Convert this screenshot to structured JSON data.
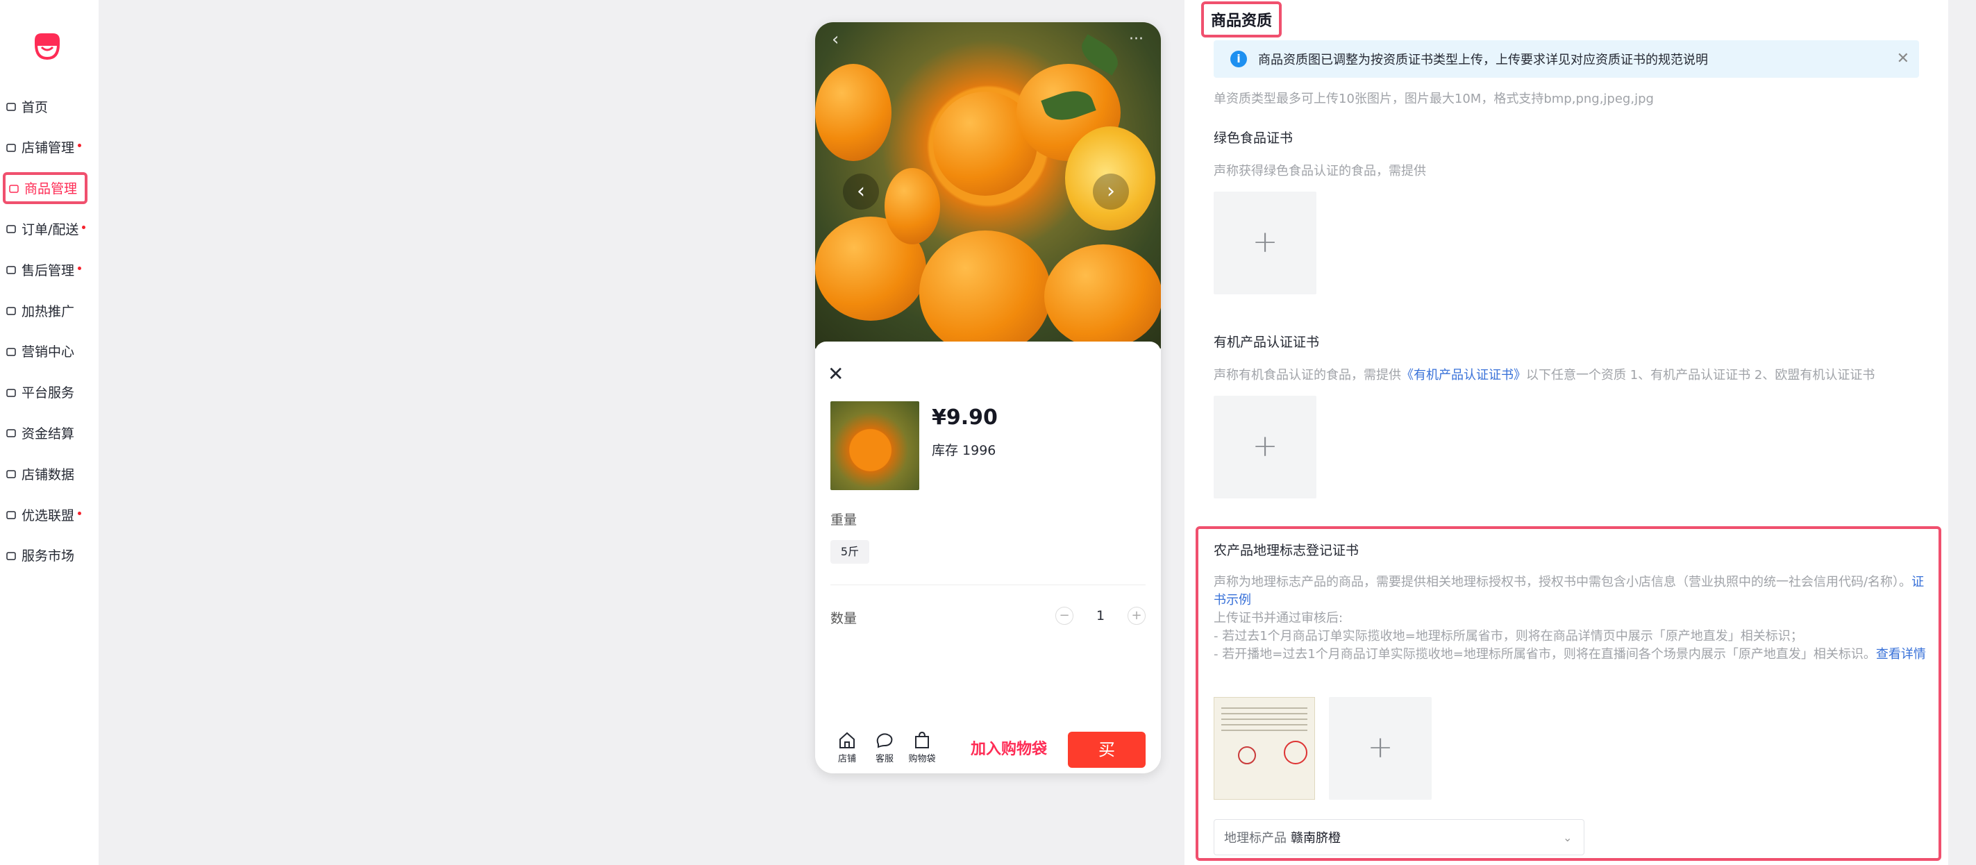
{
  "sidebar": {
    "items": [
      {
        "label": "首页",
        "dot": false,
        "active": false
      },
      {
        "label": "店铺管理",
        "dot": true,
        "active": false
      },
      {
        "label": "商品管理",
        "dot": false,
        "active": true
      },
      {
        "label": "订单/配送",
        "dot": true,
        "active": false
      },
      {
        "label": "售后管理",
        "dot": true,
        "active": false
      },
      {
        "label": "加热推广",
        "dot": false,
        "active": false
      },
      {
        "label": "营销中心",
        "dot": false,
        "active": false
      },
      {
        "label": "平台服务",
        "dot": false,
        "active": false
      },
      {
        "label": "资金结算",
        "dot": false,
        "active": false
      },
      {
        "label": "店铺数据",
        "dot": false,
        "active": false
      },
      {
        "label": "优选联盟",
        "dot": true,
        "active": false
      },
      {
        "label": "服务市场",
        "dot": false,
        "active": false
      }
    ],
    "accent_color": "#fe2c55"
  },
  "preview": {
    "back_glyph": "‹",
    "more_glyph": "···",
    "prev_glyph": "‹",
    "next_glyph": "›",
    "close_glyph": "✕",
    "price": "¥9.90",
    "stock_label": "库存 1996",
    "weight_label": "重量",
    "weight_option": "5斤",
    "quantity_label": "数量",
    "quantity": "1",
    "minus_glyph": "−",
    "plus_glyph": "+",
    "bottom": {
      "store": "店铺",
      "service": "客服",
      "bag": "购物袋",
      "add_to_cart": "加入购物袋",
      "buy": "买"
    }
  },
  "qualification": {
    "title": "商品资质",
    "notice": "商品资质图已调整为按资质证书类型上传，上传要求详见对应资质证书的规范说明",
    "upload_hint": "单资质类型最多可上传10张图片，图片最大10M，格式支持bmp,png,jpeg,jpg",
    "green": {
      "title": "绿色食品证书",
      "desc": "声称获得绿色食品认证的食品，需提供"
    },
    "organic": {
      "title": "有机产品认证证书",
      "desc_pre": "声称有机食品认证的食品，需提供",
      "desc_link": "《有机产品认证证书》",
      "desc_post": "以下任意一个资质 1、有机产品认证证书 2、欧盟有机认证证书"
    },
    "geo": {
      "title": "农产品地理标志登记证书",
      "desc1": "声称为地理标志产品的商品，需要提供相关地理标授权书，授权书中需包含小店信息（营业执照中的统一社会信用代码/名称）。",
      "desc1_link": "证书示例",
      "desc2": "上传证书并通过审核后:",
      "desc3": "- 若过去1个月商品订单实际揽收地=地理标所属省市，则将在商品详情页中展示「原产地直发」相关标识；",
      "desc4": "- 若开播地=过去1个月商品订单实际揽收地=地理标所属省市，则将在直播间各个场景内展示「原产地直发」相关标识。",
      "desc4_link": "查看详情",
      "select_label": "地理标产品",
      "select_value": "赣南脐橙"
    },
    "plus_glyph": "+"
  }
}
